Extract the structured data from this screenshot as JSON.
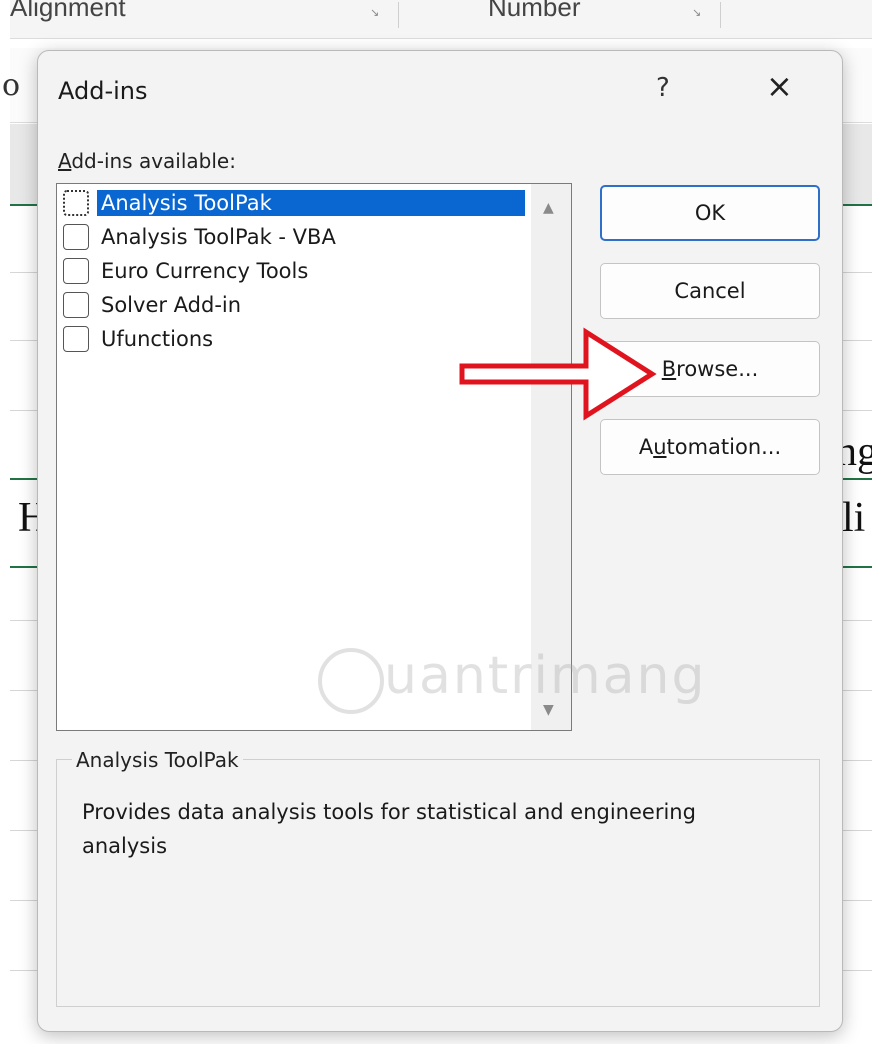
{
  "background": {
    "ribbon_groups": [
      "Alignment",
      "Number"
    ],
    "cell_fragment": "o",
    "sheet_fragments": [
      "ng",
      "H",
      "li"
    ]
  },
  "dialog": {
    "title": "Add-ins",
    "help": "?",
    "close": "×",
    "available_label_accel": "A",
    "available_label_rest": "dd-ins available:",
    "items": [
      {
        "label": "Analysis ToolPak",
        "checked": false,
        "selected": true
      },
      {
        "label": "Analysis ToolPak - VBA",
        "checked": false,
        "selected": false
      },
      {
        "label": "Euro Currency Tools",
        "checked": false,
        "selected": false
      },
      {
        "label": "Solver Add-in",
        "checked": false,
        "selected": false
      },
      {
        "label": "Ufunctions",
        "checked": false,
        "selected": false
      }
    ],
    "buttons": {
      "ok": "OK",
      "cancel": "Cancel",
      "browse_accel": "B",
      "browse_rest": "rowse...",
      "automation_pre": "A",
      "automation_accel": "u",
      "automation_rest": "tomation..."
    },
    "description": {
      "title": "Analysis ToolPak",
      "body": "Provides data analysis tools for statistical and engineering analysis"
    }
  },
  "watermark": "uantrimang",
  "colors": {
    "selection": "#0a66d0",
    "arrow": "#e0141e",
    "default_button_border": "#2d6fc9",
    "excel_green": "#217346"
  }
}
